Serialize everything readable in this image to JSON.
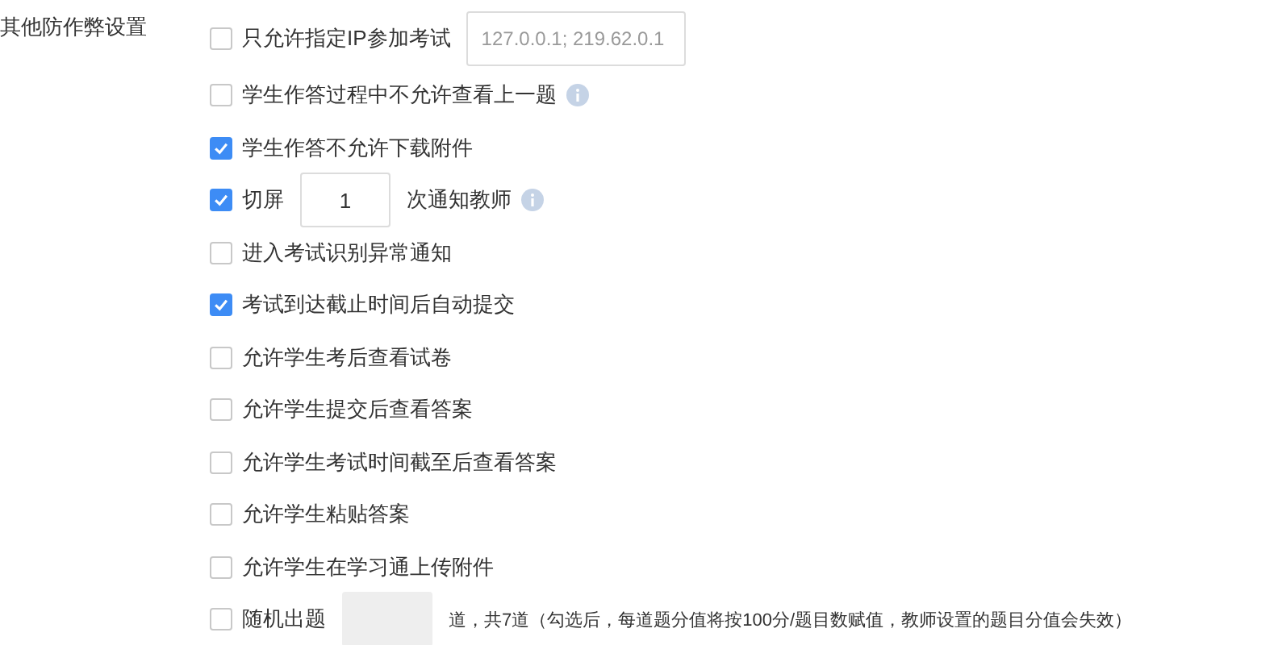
{
  "section_label": "其他防作弊设置",
  "options": [
    {
      "kind": "ip",
      "label": "只允许指定IP参加考试",
      "checked": false,
      "placeholder": "127.0.0.1; 219.62.0.1"
    },
    {
      "kind": "info",
      "label": "学生作答过程中不允许查看上一题",
      "checked": false
    },
    {
      "kind": "plain",
      "label": "学生作答不允许下载附件",
      "checked": true
    },
    {
      "kind": "count",
      "label": "切屏",
      "checked": true,
      "value": "1",
      "suffix": "次通知教师"
    },
    {
      "kind": "plain",
      "label": "进入考试识别异常通知",
      "checked": false
    },
    {
      "kind": "plain",
      "label": "考试到达截止时间后自动提交",
      "checked": true
    },
    {
      "kind": "plain",
      "label": "允许学生考后查看试卷",
      "checked": false
    },
    {
      "kind": "plain",
      "label": "允许学生提交后查看答案",
      "checked": false
    },
    {
      "kind": "plain",
      "label": "允许学生考试时间截至后查看答案",
      "checked": false
    },
    {
      "kind": "plain",
      "label": "允许学生粘贴答案",
      "checked": false
    },
    {
      "kind": "plain",
      "label": "允许学生在学习通上传附件",
      "checked": false
    },
    {
      "kind": "random",
      "label": "随机出题",
      "checked": false,
      "suffix": "道，共7道（勾选后，每道题分值将按100分/题目数赋值，教师设置的题目分值会失效）"
    }
  ]
}
